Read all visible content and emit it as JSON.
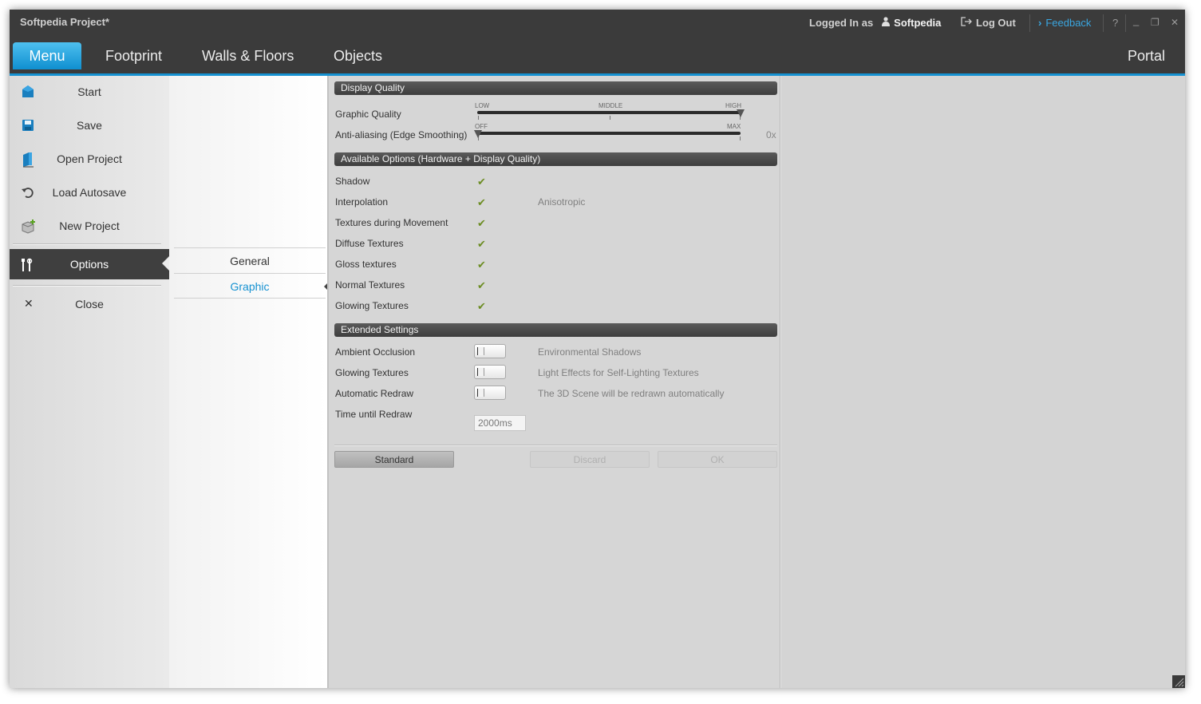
{
  "titlebar": {
    "app_title": "Softpedia Project*",
    "logged_in_label": "Logged In as",
    "username": "Softpedia",
    "logout_label": "Log Out",
    "feedback_label": "Feedback",
    "help_label": "?",
    "minimize_label": "_",
    "restore_label": "❐",
    "close_label": "✕"
  },
  "nav": {
    "tabs": [
      {
        "label": "Menu",
        "active": true
      },
      {
        "label": "Footprint"
      },
      {
        "label": "Walls & Floors"
      },
      {
        "label": "Objects"
      }
    ],
    "portal_label": "Portal"
  },
  "sidebar": {
    "items": [
      {
        "label": "Start",
        "icon": "home-icon"
      },
      {
        "label": "Save",
        "icon": "floppy-icon"
      },
      {
        "label": "Open Project",
        "icon": "open-project-icon"
      },
      {
        "label": "Load Autosave",
        "icon": "undo-icon"
      },
      {
        "label": "New Project",
        "icon": "new-project-icon"
      },
      {
        "label": "Options",
        "icon": "options-icon",
        "active": true
      },
      {
        "label": "Close",
        "icon": "close-icon"
      }
    ]
  },
  "submenu": {
    "items": [
      {
        "label": "General"
      },
      {
        "label": "Graphic",
        "active": true
      }
    ]
  },
  "display_quality": {
    "header": "Display Quality",
    "graphic_quality_label": "Graphic Quality",
    "gq_ticks": [
      "LOW",
      "MIDDLE",
      "HIGH"
    ],
    "gq_value": "HIGH",
    "antialias_label": "Anti-aliasing (Edge Smoothing)",
    "aa_ticks": [
      "OFF",
      "MAX"
    ],
    "aa_value": "0x"
  },
  "available_options": {
    "header": "Available Options (Hardware + Display Quality)",
    "rows": [
      {
        "label": "Shadow",
        "checked": true
      },
      {
        "label": "Interpolation",
        "checked": true,
        "note": "Anisotropic"
      },
      {
        "label": "Textures during Movement",
        "checked": true
      },
      {
        "label": "Diffuse Textures",
        "checked": true
      },
      {
        "label": "Gloss textures",
        "checked": true
      },
      {
        "label": "Normal Textures",
        "checked": true
      },
      {
        "label": "Glowing Textures",
        "checked": true
      }
    ],
    "check_glyph": "✔"
  },
  "extended_settings": {
    "header": "Extended Settings",
    "rows": [
      {
        "label": "Ambient Occlusion",
        "note": "Environmental Shadows"
      },
      {
        "label": "Glowing Textures",
        "note": "Light Effects for Self-Lighting Textures"
      },
      {
        "label": "Automatic Redraw",
        "note": "The 3D Scene will be redrawn automatically"
      }
    ],
    "redraw_label": "Time until Redraw",
    "redraw_value": "2000ms"
  },
  "buttons": {
    "standard": "Standard",
    "discard": "Discard",
    "ok": "OK"
  },
  "colors": {
    "accent": "#1591d1",
    "titlebar": "#3b3b3b",
    "check": "#6c8d23"
  }
}
